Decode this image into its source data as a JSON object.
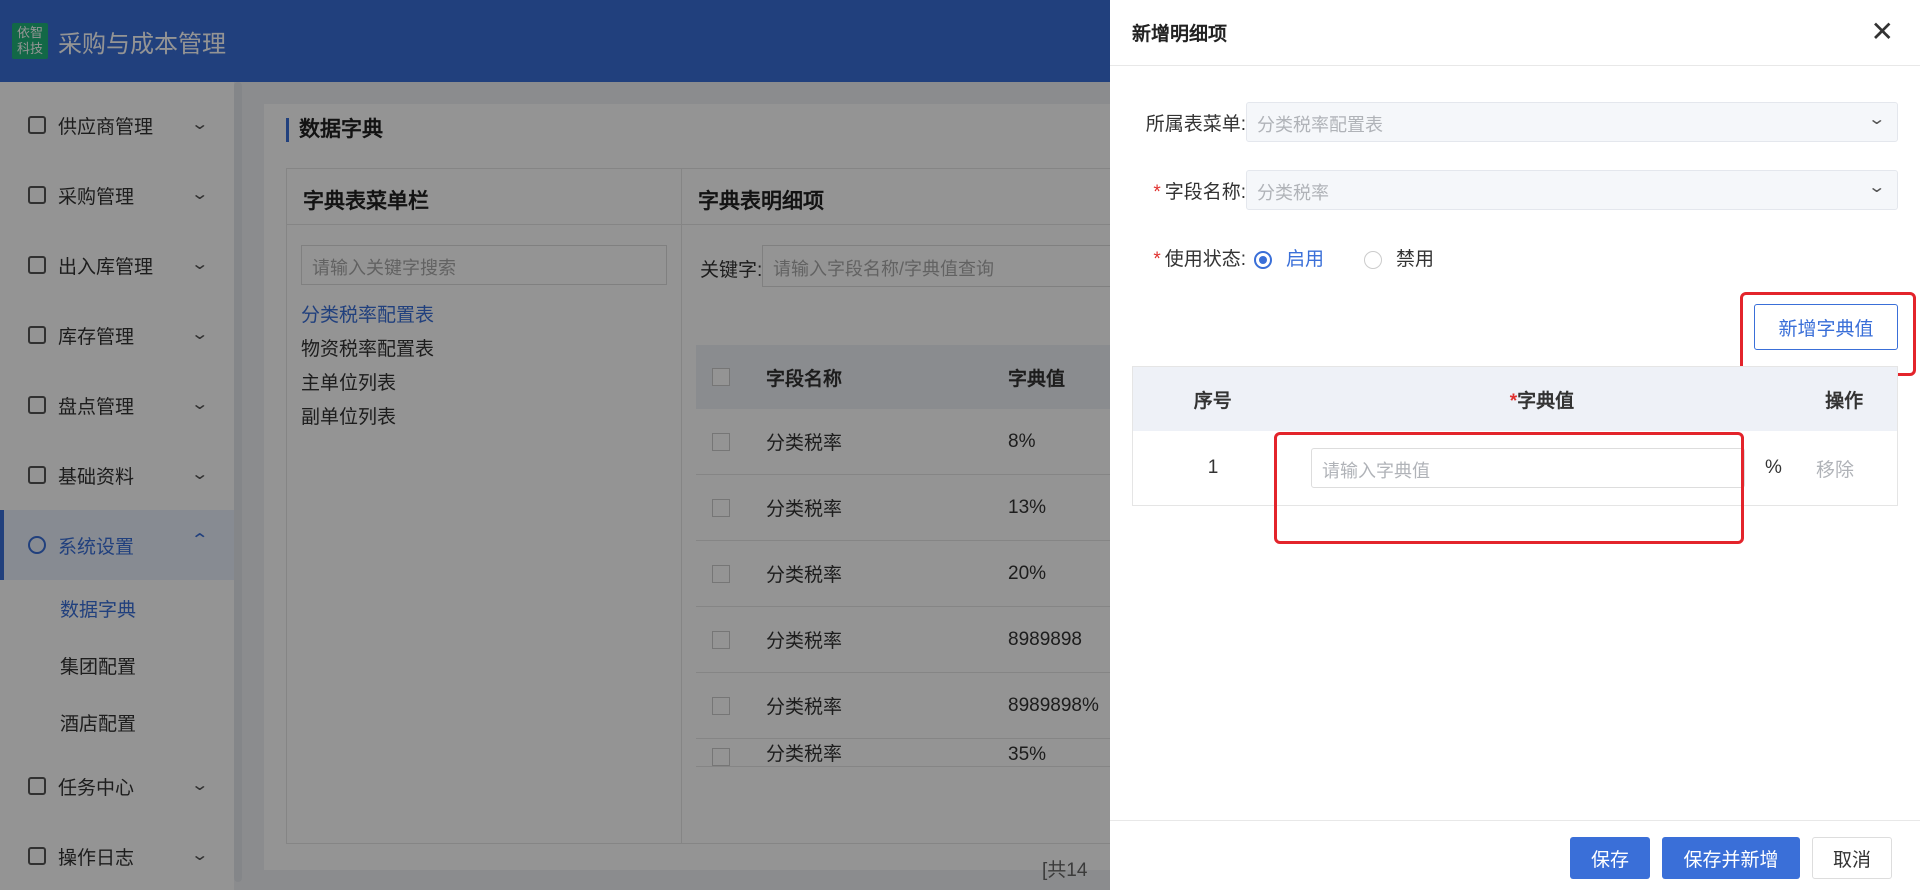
{
  "app": {
    "logo_text": "依智科技",
    "title": "采购与成本管理"
  },
  "sidebar": {
    "items": [
      {
        "label": "供应商管理"
      },
      {
        "label": "采购管理"
      },
      {
        "label": "出入库管理"
      },
      {
        "label": "库存管理"
      },
      {
        "label": "盘点管理"
      },
      {
        "label": "基础资料"
      },
      {
        "label": "系统设置"
      },
      {
        "label": "任务中心"
      },
      {
        "label": "操作日志"
      }
    ],
    "sub_items": [
      {
        "label": "数据字典"
      },
      {
        "label": "集团配置"
      },
      {
        "label": "酒店配置"
      }
    ]
  },
  "page": {
    "title": "数据字典",
    "left_panel": {
      "title": "字典表菜单栏",
      "search_placeholder": "请输入关键字搜索",
      "items": [
        "分类税率配置表",
        "物资税率配置表",
        "主单位列表",
        "副单位列表"
      ]
    },
    "right_panel": {
      "title": "字典表明细项",
      "keyword_label": "关键字:",
      "keyword_placeholder": "请输入字段名称/字典值查询",
      "columns": [
        "字段名称",
        "字典值"
      ],
      "rows": [
        [
          "分类税率",
          "8%"
        ],
        [
          "分类税率",
          "13%"
        ],
        [
          "分类税率",
          "20%"
        ],
        [
          "分类税率",
          "8989898"
        ],
        [
          "分类税率",
          "8989898%"
        ],
        [
          "分类税率",
          "35%"
        ]
      ],
      "pager_text": "[共14"
    }
  },
  "drawer": {
    "title": "新增明细项",
    "form": {
      "menu_label": "所属表菜单:",
      "menu_value": "分类税率配置表",
      "field_label": "字段名称:",
      "field_value": "分类税率",
      "status_label": "使用状态:",
      "status_on": "启用",
      "status_off": "禁用"
    },
    "add_value_button": "新增字典值",
    "table": {
      "col_index": "序号",
      "col_value": "字典值",
      "col_action": "操作",
      "rows": [
        {
          "index": "1",
          "placeholder": "请输入字典值",
          "unit": "%",
          "action": "移除"
        }
      ]
    },
    "footer": {
      "save": "保存",
      "save_add": "保存并新增",
      "cancel": "取消"
    }
  },
  "colors": {
    "primary": "#3a6fd8",
    "highlight": "#e3242b",
    "logo_bg": "#1fb37a"
  },
  "icons": [
    "close-icon",
    "chevron-down-icon",
    "chevron-up-icon",
    "menu-icons",
    "settings-gear-icon"
  ]
}
